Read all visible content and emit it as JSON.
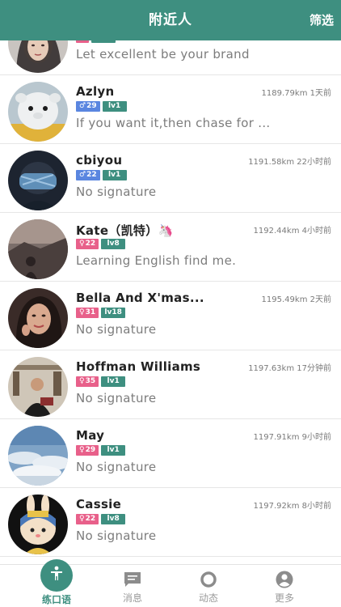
{
  "header": {
    "title": "附近人",
    "filter_label": "筛选"
  },
  "users": [
    {
      "name": "",
      "gender": "female",
      "age": "",
      "level": "",
      "distance": "",
      "time": "",
      "signature": "Let  excellent be your brand",
      "avatar": "woman-portrait"
    },
    {
      "name": "Azlyn",
      "gender": "male",
      "age": "29",
      "level": "lv1",
      "distance": "1189.79km",
      "time": "1天前",
      "signature": "If you want it,then chase for ...",
      "avatar": "white-plush-toy"
    },
    {
      "name": "cbiyou",
      "gender": "male",
      "age": "22",
      "level": "lv1",
      "distance": "1191.58km",
      "time": "22小时前",
      "signature": "No signature",
      "avatar": "masked-face"
    },
    {
      "name": "Kate（凯特）🦄",
      "gender": "female",
      "age": "22",
      "level": "lv8",
      "distance": "1192.44km",
      "time": "4小时前",
      "signature": "Learning English find me.",
      "avatar": "silhouette-landscape"
    },
    {
      "name": "Bella  And  X'mas...",
      "gender": "female",
      "age": "31",
      "level": "lv18",
      "distance": "1195.49km",
      "time": "2天前",
      "signature": "No signature",
      "avatar": "woman-selfie"
    },
    {
      "name": "Hoffman Williams",
      "gender": "female",
      "age": "35",
      "level": "lv1",
      "distance": "1197.63km",
      "time": "17分钟前",
      "signature": "No signature",
      "avatar": "man-in-shop"
    },
    {
      "name": "May",
      "gender": "female",
      "age": "29",
      "level": "lv1",
      "distance": "1197.91km",
      "time": "9小时前",
      "signature": "No signature",
      "avatar": "sky-clouds"
    },
    {
      "name": "Cassie",
      "gender": "female",
      "age": "22",
      "level": "lv8",
      "distance": "1197.92km",
      "time": "8小时前",
      "signature": "No signature",
      "avatar": "cartoon-bunny"
    }
  ],
  "tabs": [
    {
      "label": "练口语",
      "icon": "person-icon",
      "active": true
    },
    {
      "label": "消息",
      "icon": "message-icon",
      "active": false
    },
    {
      "label": "动态",
      "icon": "ring-icon",
      "active": false
    },
    {
      "label": "更多",
      "icon": "profile-icon",
      "active": false
    }
  ],
  "colors": {
    "primary": "#3e8f80",
    "male_badge": "#5a86e0",
    "female_badge": "#e8608a",
    "inactive_tab": "#9a9a9a"
  }
}
